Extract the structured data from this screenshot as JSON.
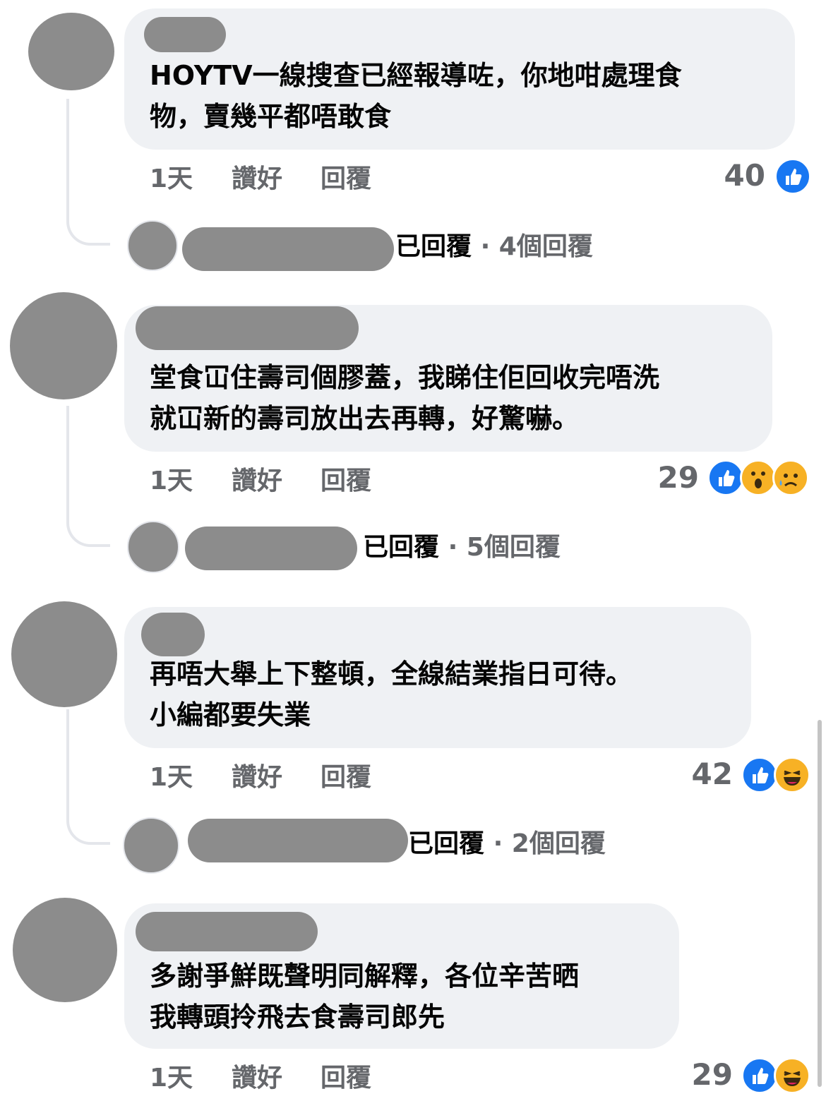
{
  "comments": [
    {
      "text_lines": [
        "HOYTV一線搜查已經報導咗，你地咁處理食",
        "物，賣幾平都唔敢食"
      ],
      "time": "1天",
      "like_label": "讚好",
      "reply_label": "回覆",
      "reaction_count": "40",
      "reactions": [
        "like-icon"
      ],
      "replies": {
        "replied_label": "已回覆",
        "separator": "·",
        "count_label": "4個回覆"
      }
    },
    {
      "text_lines": [
        "堂食冚住壽司個膠蓋，我睇住佢回收完唔洗",
        "就冚新的壽司放出去再轉，好驚嚇。"
      ],
      "time": "1天",
      "like_label": "讚好",
      "reply_label": "回覆",
      "reaction_count": "29",
      "reactions": [
        "like-icon",
        "wow-icon",
        "sad-icon"
      ],
      "replies": {
        "replied_label": "已回覆",
        "separator": "·",
        "count_label": "5個回覆"
      }
    },
    {
      "text_lines": [
        "再唔大舉上下整頓，全線結業指日可待。",
        "小編都要失業"
      ],
      "time": "1天",
      "like_label": "讚好",
      "reply_label": "回覆",
      "reaction_count": "42",
      "reactions": [
        "like-icon",
        "haha-icon"
      ],
      "replies": {
        "replied_label": "已回覆",
        "separator": "·",
        "count_label": "2個回覆"
      }
    },
    {
      "text_lines": [
        "多謝爭鮮既聲明同解釋，各位辛苦晒",
        "我轉頭拎飛去食壽司郎先"
      ],
      "time": "1天",
      "like_label": "讚好",
      "reply_label": "回覆",
      "reaction_count": "29",
      "reactions": [
        "like-icon",
        "haha-icon"
      ]
    }
  ],
  "colors": {
    "bubble": "#eff1f4",
    "meta_text": "#65676b",
    "body_text": "#050505",
    "like_blue": "#1877f2",
    "emoji_yellow": "#f7b125",
    "redaction_gray": "#8c8c8c"
  }
}
